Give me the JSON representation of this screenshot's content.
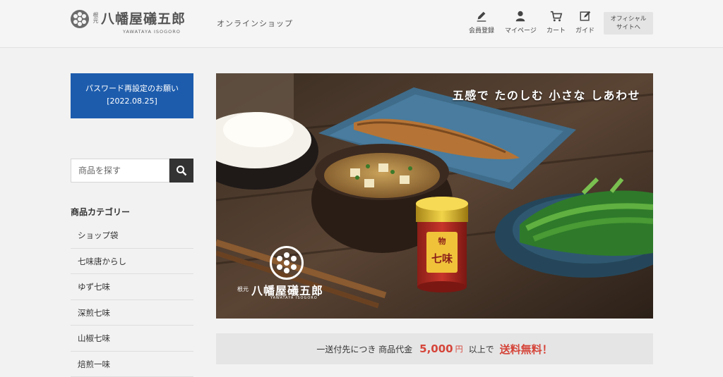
{
  "header": {
    "logo_small": "根元",
    "logo_name": "八幡屋礒五郎",
    "logo_en": "YAWATAYA ISOGORO",
    "shop_label": "オンラインショップ",
    "nav": [
      {
        "label": "会員登録",
        "icon": "pencil-icon"
      },
      {
        "label": "マイページ",
        "icon": "user-icon"
      },
      {
        "label": "カート",
        "icon": "cart-icon"
      },
      {
        "label": "ガイド",
        "icon": "edit-icon"
      }
    ],
    "official_line1": "オフィシャル",
    "official_line2": "サイトへ"
  },
  "sidebar": {
    "notice_line1": "パスワード再設定のお願い",
    "notice_line2": "[2022.08.25]",
    "search_placeholder": "商品を探す",
    "category_title": "商品カテゴリー",
    "categories": [
      "ショップ袋",
      "七味唐からし",
      "ゆず七味",
      "深煎七味",
      "山椒七味",
      "焙煎一味"
    ]
  },
  "hero": {
    "copy": "五感で たのしむ 小さな しあわせ",
    "logo_small": "根元",
    "logo_name": "八幡屋礒五郎",
    "logo_en": "YAWATAYA ISOGORO",
    "can_label_top": "物",
    "can_label_main": "七味"
  },
  "shipping": {
    "prefix": "一送付先につき 商品代金",
    "amount": "5,000",
    "yen": "円",
    "suffix": "以上で",
    "free": "送料無料！"
  },
  "colors": {
    "notice_bg": "#1d5cad",
    "accent_red": "#d5453a"
  }
}
